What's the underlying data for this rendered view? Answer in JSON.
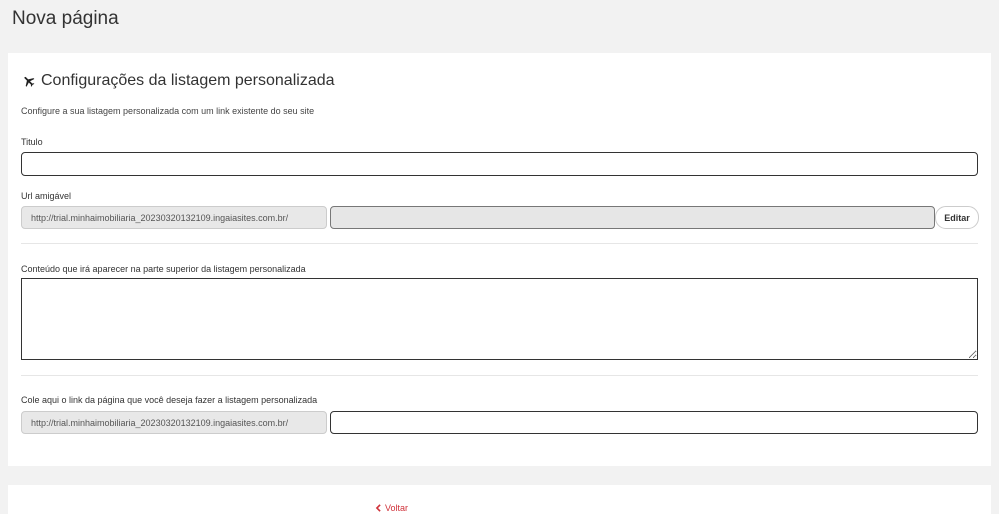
{
  "page": {
    "title": "Nova página"
  },
  "section": {
    "title": "Configurações da listagem personalizada",
    "icon": "plane-icon",
    "subtitle": "Configure a sua listagem personalizada com um link existente do seu site"
  },
  "fields": {
    "title_label": "Titulo",
    "title_value": "",
    "url_label": "Url amigável",
    "url_prefix": "http://trial.minhaimobiliaria_20230320132109.ingaiasites.com.br/",
    "url_value": "",
    "edit_label": "Editar",
    "content_label": "Conteúdo que irá aparecer na parte superior da listagem personalizada",
    "content_value": "",
    "link_label": "Cole aqui o link da página que você deseja fazer a listagem personalizada",
    "link_prefix": "http://trial.minhaimobiliaria_20230320132109.ingaiasites.com.br/",
    "link_value": ""
  },
  "footer": {
    "back_label": "Voltar",
    "back_icon": "chevron-left-icon",
    "accent": "#d0323a"
  }
}
